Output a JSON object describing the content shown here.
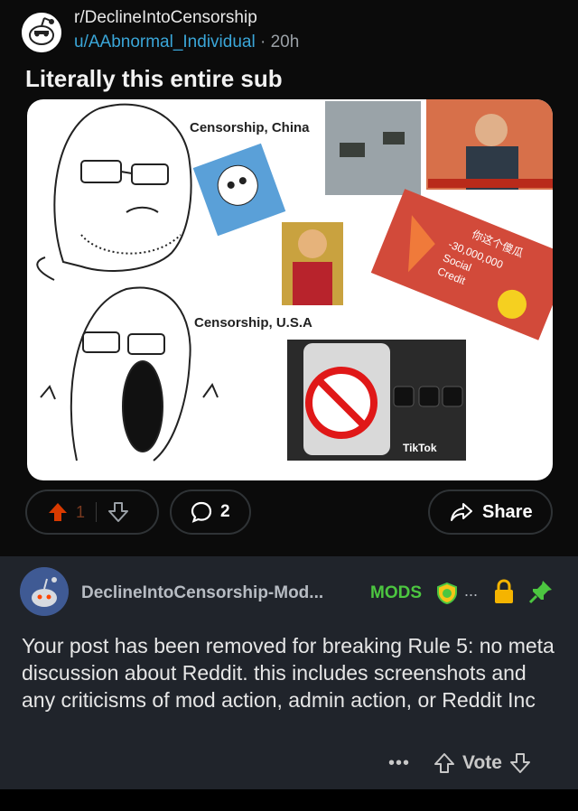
{
  "post": {
    "subreddit": "r/DeclineIntoCensorship",
    "author": "u/AAbnormal_Individual",
    "separator": "·",
    "age": "20h",
    "title": "Literally this entire sub",
    "image": {
      "label_china": "Censorship, China",
      "label_usa": "Censorship, U.S.A",
      "social_credit_cn": "你这个傻瓜",
      "social_credit_amount": "-30,000,000",
      "social_credit_line1": "Social",
      "social_credit_line2": "Credit",
      "tiktok_label": "TikTok"
    },
    "upvotes": "1",
    "comments": "2",
    "share_label": "Share"
  },
  "comment": {
    "author": "DeclineIntoCensorship-Mod...",
    "flair": "MODS",
    "ellipsis": "...",
    "body": "Your post has been removed for breaking Rule 5: no meta discussion about Reddit. this includes screenshots and any criticisms of mod action, admin action, or Reddit Inc",
    "more": "•••",
    "vote_label": "Vote"
  },
  "colors": {
    "upvote_active": "#d93a00",
    "link_blue": "#3aa6d8",
    "mod_green": "#4cc640",
    "lock_yellow": "#f5b400"
  }
}
